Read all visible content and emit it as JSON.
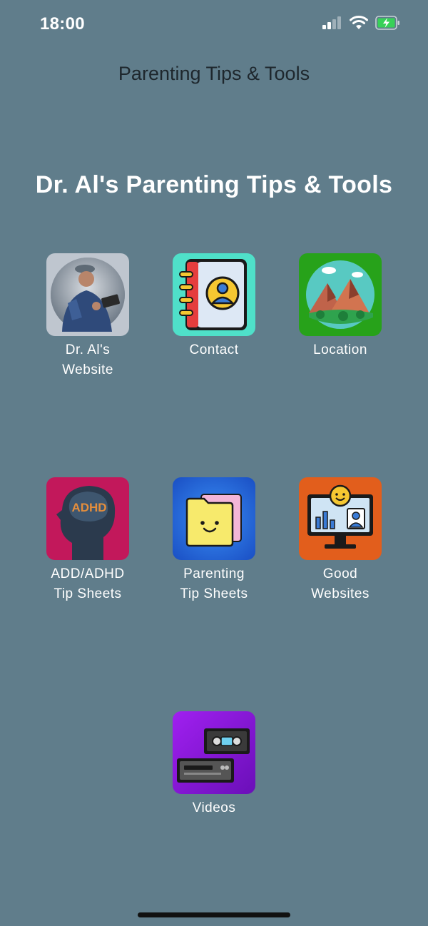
{
  "status": {
    "time": "18:00"
  },
  "nav": {
    "title": "Parenting Tips & Tools"
  },
  "heading": "Dr. Al's Parenting Tips & Tools",
  "tiles": [
    {
      "line1": "Dr. Al's",
      "line2": "Website",
      "icon": "person-photo-icon"
    },
    {
      "line1": "Contact",
      "line2": "",
      "icon": "address-book-icon"
    },
    {
      "line1": "Location",
      "line2": "",
      "icon": "mountains-icon"
    },
    {
      "line1": "ADD/ADHD",
      "line2": "Tip Sheets",
      "icon": "head-adhd-icon",
      "icon_text": "ADHD"
    },
    {
      "line1": "Parenting",
      "line2": "Tip Sheets",
      "icon": "smiley-folder-icon"
    },
    {
      "line1": "Good",
      "line2": "Websites",
      "icon": "monitor-dashboard-icon"
    },
    {
      "line1": "Videos",
      "line2": "",
      "icon": "vhs-player-icon"
    }
  ],
  "colors": {
    "background": "#607d8b",
    "nav_title": "#1e272d",
    "text": "#ffffff"
  }
}
